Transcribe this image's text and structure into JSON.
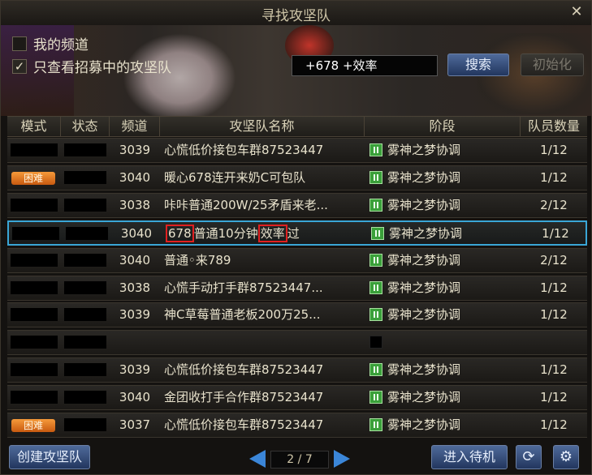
{
  "window": {
    "title": "寻找攻坚队",
    "close_glyph": "✕"
  },
  "filters": {
    "my_channel_label": "我的频道",
    "my_channel_checked": false,
    "recruiting_only_label": "只查看招募中的攻坚队",
    "recruiting_only_checked": true,
    "checked_glyph": "✓"
  },
  "search": {
    "value": "+678 +效率",
    "button_label": "搜索",
    "reset_label": "初始化"
  },
  "columns": [
    "模式",
    "状态",
    "频道",
    "攻坚队名称",
    "阶段",
    "队员数量"
  ],
  "rows": [
    {
      "mode": "",
      "status": "",
      "channel": "3039",
      "name": "心慌低价接包车群87523447",
      "stage": "雾神之梦协调",
      "members": "1/12"
    },
    {
      "mode": "困难",
      "status": "",
      "channel": "3040",
      "name": "暖心678连开来奶C可包队",
      "stage": "雾神之梦协调",
      "members": "1/12"
    },
    {
      "mode": "",
      "status": "",
      "channel": "3038",
      "name": "咔咔普通200W/25矛盾来老...",
      "stage": "雾神之梦协调",
      "members": "2/12"
    },
    {
      "mode": "",
      "status": "",
      "channel": "3040",
      "name_parts": [
        "678",
        "普通10分钟",
        "效率",
        "过"
      ],
      "stage": "雾神之梦协调",
      "members": "1/12",
      "selected": true
    },
    {
      "mode": "",
      "status": "",
      "channel": "3040",
      "name": "普通◦来789",
      "stage": "雾神之梦协调",
      "members": "2/12"
    },
    {
      "mode": "",
      "status": "",
      "channel": "3038",
      "name": "心慌手动打手群87523447...",
      "stage": "雾神之梦协调",
      "members": "1/12"
    },
    {
      "mode": "",
      "status": "",
      "channel": "3039",
      "name": "神C草莓普通老板200万25...",
      "stage": "雾神之梦协调",
      "members": "1/12"
    },
    {
      "mode": "",
      "status": "",
      "channel": "",
      "name": "",
      "stage": "",
      "members": "",
      "empty": true
    },
    {
      "mode": "",
      "status": "",
      "channel": "3039",
      "name": "心慌低价接包车群87523447",
      "stage": "雾神之梦协调",
      "members": "1/12"
    },
    {
      "mode": "",
      "status": "",
      "channel": "3040",
      "name": "金团收打手合作群87523447",
      "stage": "雾神之梦协调",
      "members": "1/12"
    },
    {
      "mode": "困难",
      "status": "",
      "channel": "3037",
      "name": "心慌低价接包车群87523447",
      "stage": "雾神之梦协调",
      "members": "1/12"
    }
  ],
  "bottom": {
    "create_label": "创建攻坚队",
    "page_current": "2",
    "page_total": "7",
    "page_sep": "/",
    "enter_queue_label": "进入待机",
    "refresh_glyph": "⟳",
    "settings_glyph": "⚙"
  },
  "colors": {
    "accent_blue": "#3b86d8",
    "selected_border": "#3aa6d6",
    "hard_badge": "#f08a2a",
    "stage_icon": "#3aa03a",
    "highlight_box": "#e02020"
  }
}
